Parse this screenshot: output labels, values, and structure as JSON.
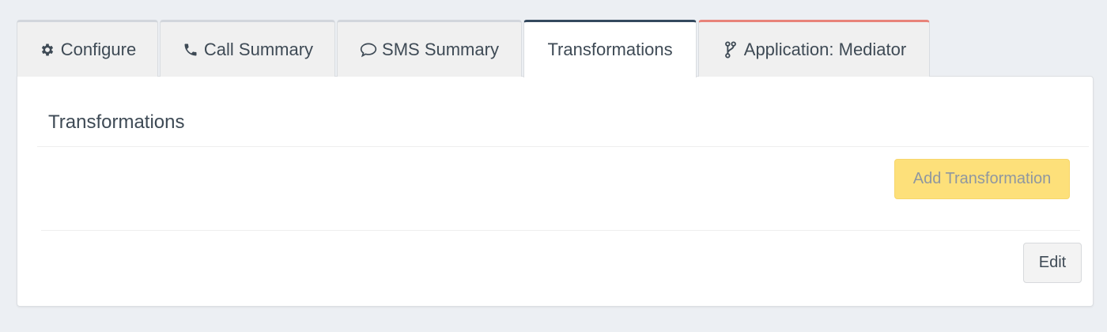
{
  "tabs": [
    {
      "label": "Configure",
      "icon": "gear-icon"
    },
    {
      "label": "Call Summary",
      "icon": "phone-icon"
    },
    {
      "label": "SMS Summary",
      "icon": "speech-bubble-icon"
    },
    {
      "label": "Transformations",
      "icon": ""
    },
    {
      "label": "Application: Mediator",
      "icon": "code-branch-icon"
    }
  ],
  "active_tab": "Transformations",
  "colors": {
    "active_tab_accent": "#34495e",
    "application_tab_accent": "#e8837a",
    "add_button_bg": "#fde07a",
    "page_bg": "#eceff3"
  },
  "panel": {
    "title": "Transformations",
    "add_button_label": "Add Transformation",
    "edit_button_label": "Edit"
  }
}
